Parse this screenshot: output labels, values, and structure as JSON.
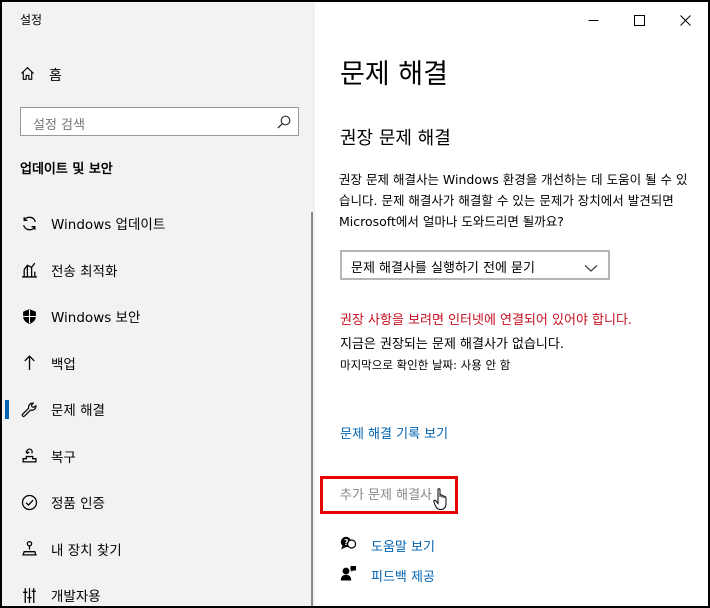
{
  "window": {
    "title": "설정"
  },
  "sidebar": {
    "home_label": "홈",
    "search_placeholder": "설정 검색",
    "section_title": "업데이트 및 보안",
    "items": [
      {
        "label": "Windows 업데이트",
        "icon": "sync-icon"
      },
      {
        "label": "전송 최적화",
        "icon": "delivery-optimization-icon"
      },
      {
        "label": "Windows 보안",
        "icon": "shield-icon"
      },
      {
        "label": "백업",
        "icon": "backup-arrow-icon"
      },
      {
        "label": "문제 해결",
        "icon": "wrench-icon",
        "selected": true
      },
      {
        "label": "복구",
        "icon": "recovery-icon"
      },
      {
        "label": "정품 인증",
        "icon": "check-circle-icon"
      },
      {
        "label": "내 장치 찾기",
        "icon": "find-device-icon"
      },
      {
        "label": "개발자용",
        "icon": "developer-icon"
      }
    ]
  },
  "main": {
    "title": "문제 해결",
    "subtitle": "권장 문제 해결",
    "description": "권장 문제 해결사는 Windows 환경을 개선하는 데 도움이 될 수 있습니다. 문제 해결사가 해결할 수 있는 문제가 장치에서 발견되면 Microsoft에서 얼마나 도와드리면 될까요?",
    "dropdown_value": "문제 해결사를 실행하기 전에 묻기",
    "warning": "권장 사항을 보려면 인터넷에 연결되어 있어야 합니다.",
    "no_troubleshooters": "지금은 권장되는 문제 해결사가 없습니다.",
    "last_checked": "마지막으로 확인한 날짜: 사용 안 함",
    "history_link": "문제 해결 기록 보기",
    "additional_link": "추가 문제 해결사",
    "help_link": "도움말 보기",
    "feedback_link": "피드백 제공"
  },
  "colors": {
    "accent": "#0063b1",
    "warning": "#c50f1f",
    "highlight_box": "#e60000"
  }
}
